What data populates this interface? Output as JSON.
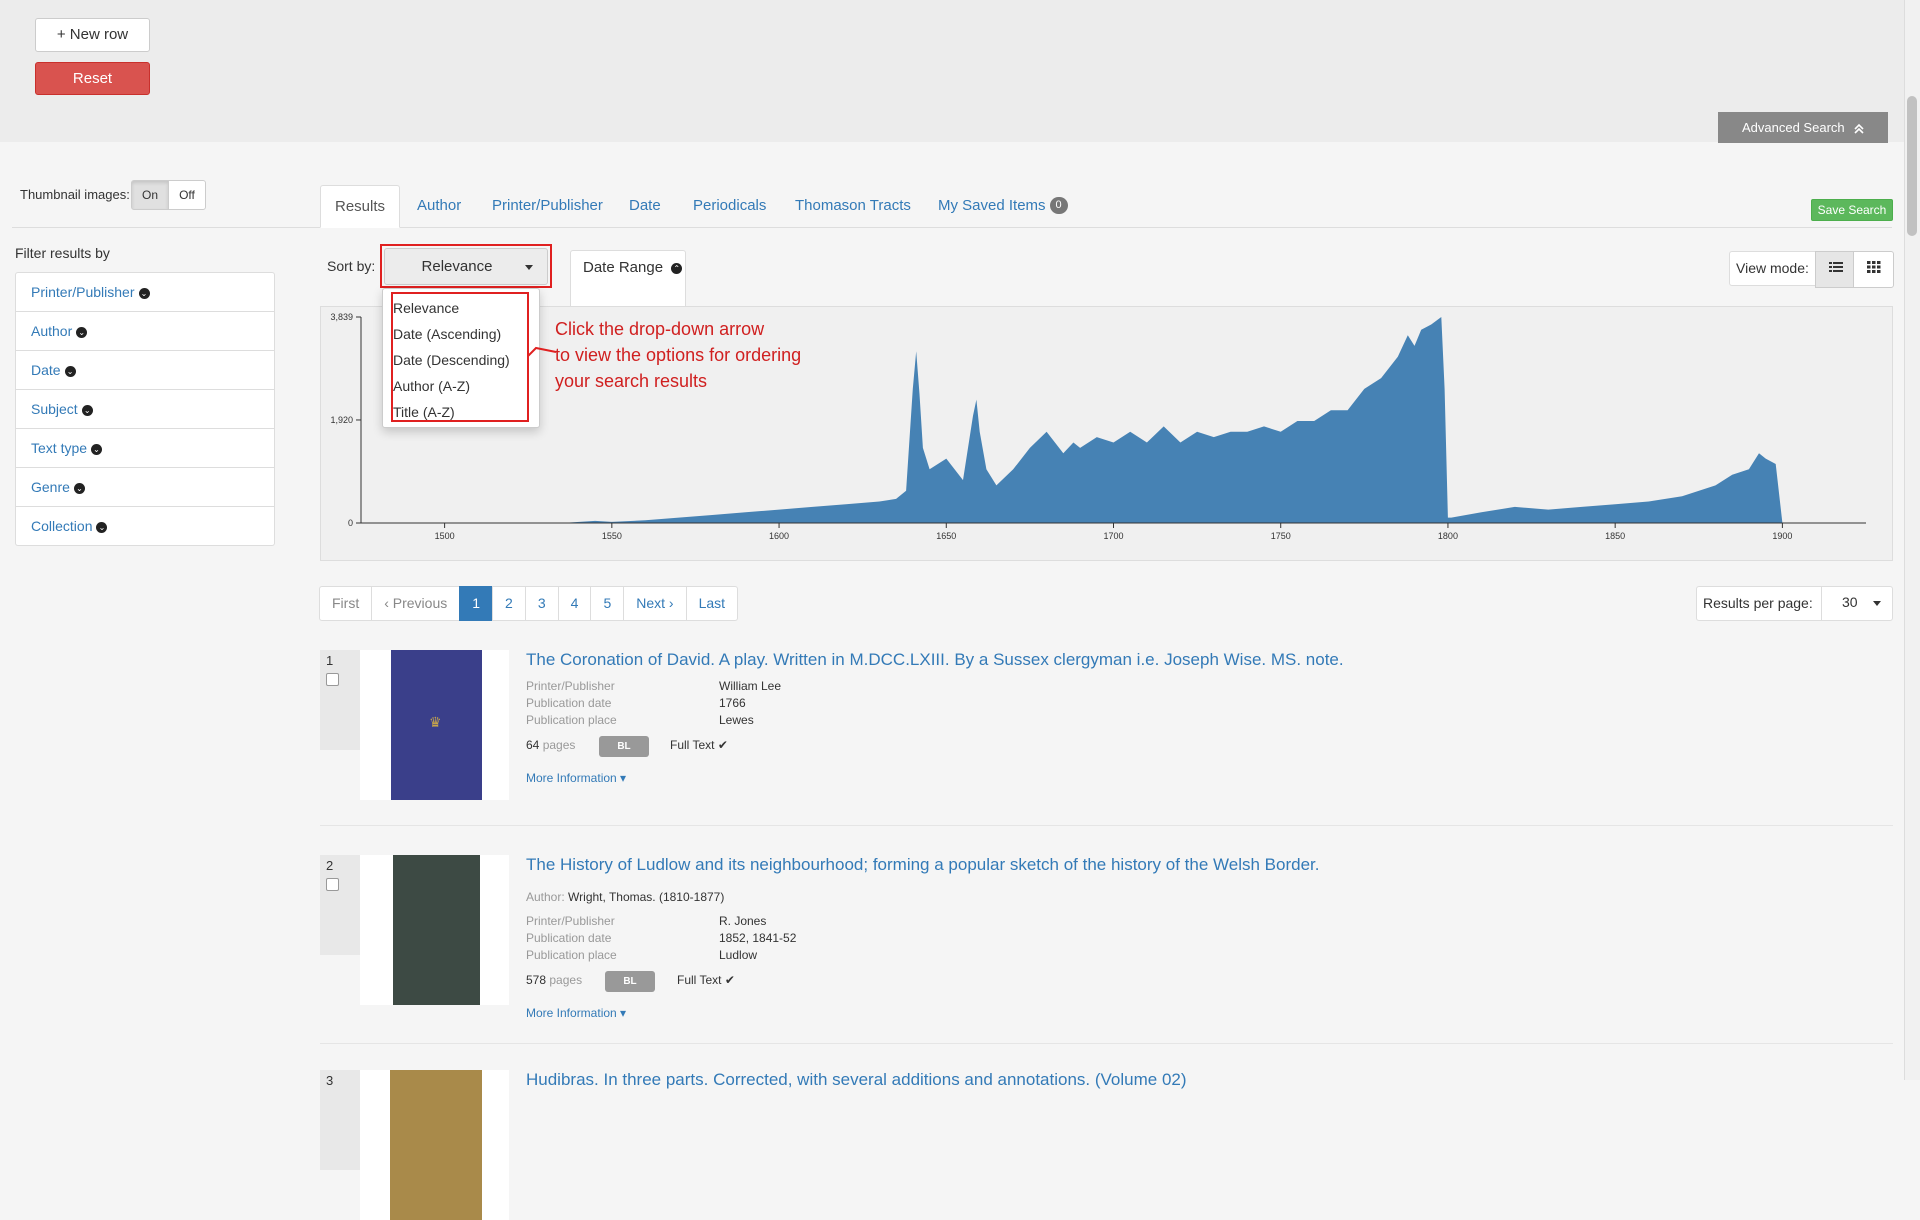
{
  "top": {
    "new_row": "+ New row",
    "reset": "Reset",
    "advanced_search": "Advanced Search"
  },
  "thumbnail": {
    "label": "Thumbnail images:",
    "on": "On",
    "off": "Off"
  },
  "tabs": [
    {
      "label": "Results"
    },
    {
      "label": "Author"
    },
    {
      "label": "Printer/Publisher"
    },
    {
      "label": "Date"
    },
    {
      "label": "Periodicals"
    },
    {
      "label": "Thomason Tracts"
    },
    {
      "label": "My Saved Items",
      "badge": "0"
    }
  ],
  "save_search": "Save Search",
  "filters": {
    "title": "Filter results by",
    "items": [
      "Printer/Publisher",
      "Author",
      "Date",
      "Subject",
      "Text type",
      "Genre",
      "Collection"
    ]
  },
  "sort": {
    "label": "Sort by:",
    "selected": "Relevance",
    "options": [
      "Relevance",
      "Date (Ascending)",
      "Date (Descending)",
      "Author (A-Z)",
      "Title (A-Z)"
    ]
  },
  "date_range_tab": "Date Range",
  "view_mode": {
    "label": "View mode:"
  },
  "annotation": [
    "Click the drop-down arrow",
    "to view the options for ordering",
    "your search results"
  ],
  "chart_data": {
    "type": "area",
    "title": "",
    "xlabel": "",
    "ylabel": "",
    "x_ticks": [
      1500,
      1550,
      1600,
      1650,
      1700,
      1750,
      1800,
      1850,
      1900
    ],
    "y_ticks": [
      "0",
      "1,920",
      "3,839"
    ],
    "xlim": [
      1475,
      1925
    ],
    "ylim": [
      0,
      3839
    ],
    "color": "#4682b4",
    "series": [
      {
        "x": [
          1475,
          1535,
          1545,
          1550,
          1560,
          1570,
          1580,
          1590,
          1600,
          1610,
          1620,
          1630,
          1635,
          1638,
          1640,
          1641,
          1642,
          1643,
          1645,
          1650,
          1655,
          1658,
          1659,
          1660,
          1662,
          1665,
          1670,
          1675,
          1680,
          1685,
          1688,
          1690,
          1695,
          1700,
          1705,
          1710,
          1715,
          1720,
          1725,
          1730,
          1735,
          1740,
          1745,
          1750,
          1755,
          1760,
          1765,
          1770,
          1775,
          1780,
          1785,
          1788,
          1790,
          1792,
          1795,
          1798,
          1799,
          1800,
          1801,
          1810,
          1820,
          1830,
          1840,
          1850,
          1860,
          1870,
          1880,
          1885,
          1890,
          1893,
          1895,
          1898,
          1900,
          1925
        ],
        "values": [
          0,
          0,
          40,
          20,
          50,
          100,
          150,
          200,
          250,
          300,
          350,
          400,
          450,
          600,
          2500,
          3200,
          2400,
          1400,
          1000,
          1200,
          800,
          2000,
          2300,
          1700,
          1000,
          700,
          1000,
          1400,
          1700,
          1300,
          1500,
          1400,
          1600,
          1500,
          1700,
          1500,
          1800,
          1500,
          1700,
          1600,
          1700,
          1700,
          1800,
          1700,
          1900,
          1900,
          2100,
          2100,
          2500,
          2700,
          3100,
          3500,
          3300,
          3600,
          3700,
          3839,
          2500,
          100,
          100,
          200,
          300,
          250,
          300,
          350,
          400,
          500,
          700,
          900,
          1000,
          1300,
          1200,
          1100,
          0,
          0
        ]
      }
    ]
  },
  "pager": [
    "First",
    "‹ Previous",
    "1",
    "2",
    "3",
    "4",
    "5",
    "Next ›",
    "Last"
  ],
  "results_per_page": {
    "label": "Results per page:",
    "value": "30"
  },
  "results": [
    {
      "num": "1",
      "title": "The Coronation of David. A play. Written in M.DCC.LXIII. By a Sussex clergyman i.e. Joseph Wise. MS. note.",
      "fields": [
        {
          "k": "Printer/Publisher",
          "v": "William Lee"
        },
        {
          "k": "Publication date",
          "v": "1766"
        },
        {
          "k": "Publication place",
          "v": "Lewes"
        }
      ],
      "pages_num": "64",
      "pages_label": "pages",
      "badge": "BL",
      "full_text": "Full Text",
      "more": "More Information",
      "cover_color": "#3a3f8a"
    },
    {
      "num": "2",
      "title": "The History of Ludlow and its neighbourhood; forming a popular sketch of the history of the Welsh Border.",
      "author_label": "Author:",
      "author": "Wright, Thomas. (1810-1877)",
      "fields": [
        {
          "k": "Printer/Publisher",
          "v": "R. Jones"
        },
        {
          "k": "Publication date",
          "v": "1852, 1841-52"
        },
        {
          "k": "Publication place",
          "v": "Ludlow"
        }
      ],
      "pages_num": "578",
      "pages_label": "pages",
      "badge": "BL",
      "full_text": "Full Text",
      "more": "More Information",
      "cover_color": "#3d4a44"
    },
    {
      "num": "3",
      "title": "Hudibras. In three parts. Corrected, with several additions and annotations. (Volume 02)",
      "cover_color": "#a98a4a"
    }
  ]
}
